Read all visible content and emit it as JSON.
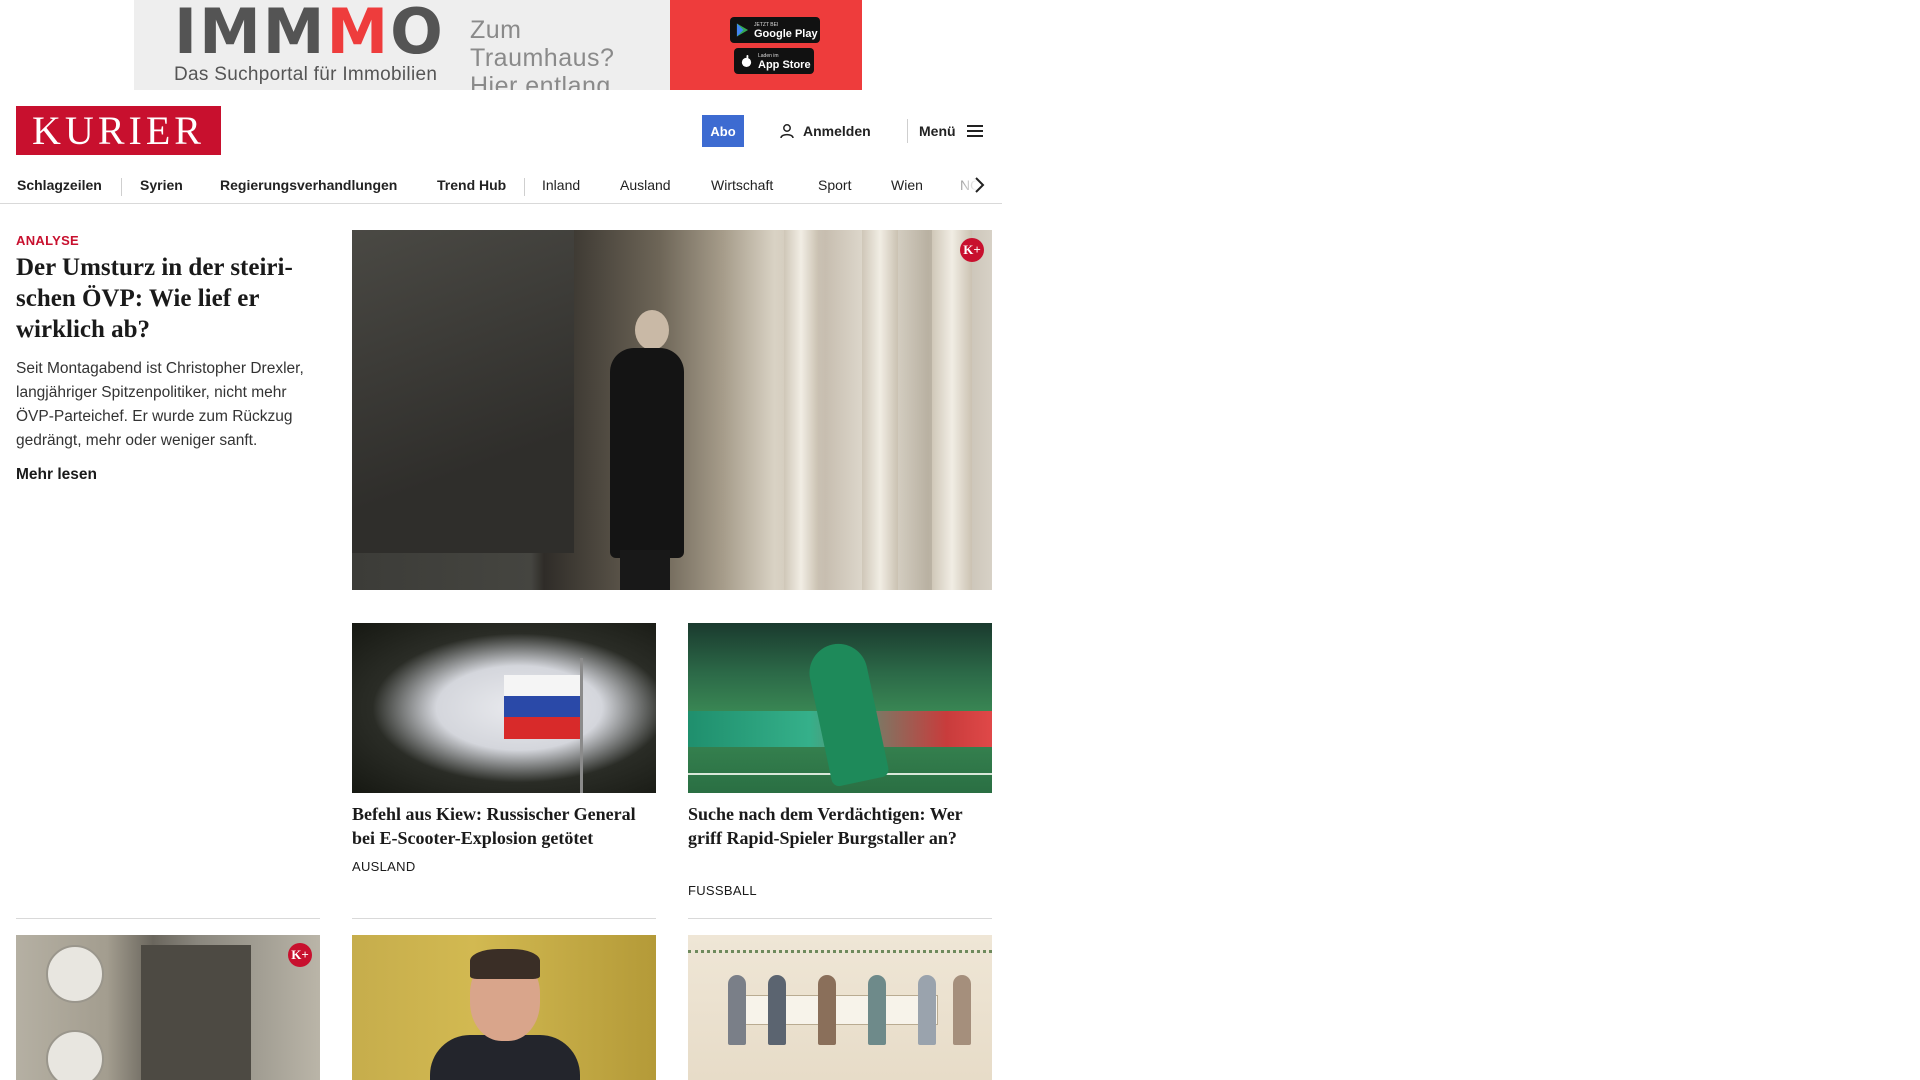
{
  "ad": {
    "logo_part1": "IMM",
    "logo_red": "M",
    "logo_part2": "O",
    "subline": "Das Suchportal für Immobilien",
    "claim_line1": "Zum Traumhaus?",
    "claim_line2": "Hier entlang.",
    "google_small": "JETZT BEI",
    "google_big": "Google Play",
    "apple_small": "Laden im",
    "apple_big": "App Store"
  },
  "header": {
    "logo": "KURIER",
    "abo_label": "Abo",
    "login_label": "Anmelden",
    "menu_label": "Menü"
  },
  "nav": {
    "items": [
      "Schlagzeilen",
      "Syrien",
      "Regierungsverhandlungen",
      "Trend Hub",
      "Inland",
      "Ausland",
      "Wirtschaft",
      "Sport",
      "Wien",
      "NÖ"
    ]
  },
  "lead": {
    "kicker": "ANALYSE",
    "title": "Der Umsturz in der steiri­schen ÖVP: Wie lief er wirklich ab?",
    "teaser": "Seit Montagabend ist Christopher Drexler, langjähriger Spitzenpolitiker, nicht mehr ÖVP-Parteichef. Er wurde zum Rückzug gedrängt, mehr oder weniger sanft.",
    "read_more": "Mehr lesen",
    "premium_badge": "K+"
  },
  "cards": [
    {
      "title": "Befehl aus Kiew: Russischer Gene­ral bei E-Scooter-Explosion getötet",
      "tag": "AUSLAND"
    },
    {
      "title": "Suche nach dem Verdächtigen: Wer griff Rapid-Spieler Burgstaller an?",
      "tag": "FUSSBALL"
    }
  ],
  "bottom": {
    "premium_badge": "K+"
  },
  "colors": {
    "brand_red": "#c8102e",
    "abo_blue": "#3d6bd1",
    "ad_red": "#ee3c3c"
  }
}
